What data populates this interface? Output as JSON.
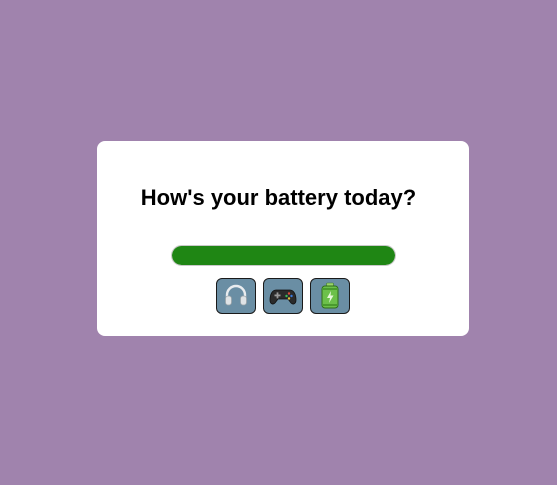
{
  "prompt": {
    "title": "How's your battery today?"
  },
  "battery": {
    "level_percent": 100,
    "fill_color": "#1f8614",
    "track_color": "#d9d9d9"
  },
  "icons": [
    {
      "name": "headphones-icon"
    },
    {
      "name": "game-controller-icon"
    },
    {
      "name": "battery-charging-icon"
    }
  ],
  "colors": {
    "background": "#a083ad",
    "card": "#ffffff",
    "icon_button_bg": "#6a8ea4"
  }
}
